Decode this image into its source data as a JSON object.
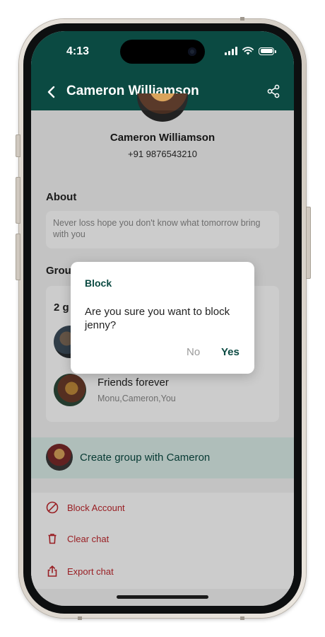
{
  "status_bar": {
    "time": "4:13"
  },
  "header": {
    "title": "Cameron Williamson",
    "back_icon": "chevron-left-icon",
    "share_icon": "share-icon"
  },
  "profile": {
    "name": "Cameron Williamson",
    "phone": "+91 9876543210"
  },
  "about": {
    "title": "About",
    "text": "Never loss hope you don't know what tomorrow bring with you"
  },
  "groups": {
    "title": "Grou",
    "count_label": "2 g",
    "items": [
      {
        "name": "Friends forever",
        "members": "Monu,Cameron,You"
      }
    ]
  },
  "create_group": {
    "label": "Create group with Cameron"
  },
  "actions": [
    {
      "label": "Block Account",
      "icon": "block-icon"
    },
    {
      "label": "Clear chat",
      "icon": "trash-icon"
    },
    {
      "label": "Export chat",
      "icon": "export-icon"
    }
  ],
  "dialog": {
    "title": "Block",
    "message": "Are you sure you want to block jenny?",
    "no_label": "No",
    "yes_label": "Yes"
  },
  "colors": {
    "header_bg": "#0b4a42",
    "accent": "#0b4a42",
    "danger": "#c0272d",
    "create_group_bg": "#dbeee9"
  }
}
